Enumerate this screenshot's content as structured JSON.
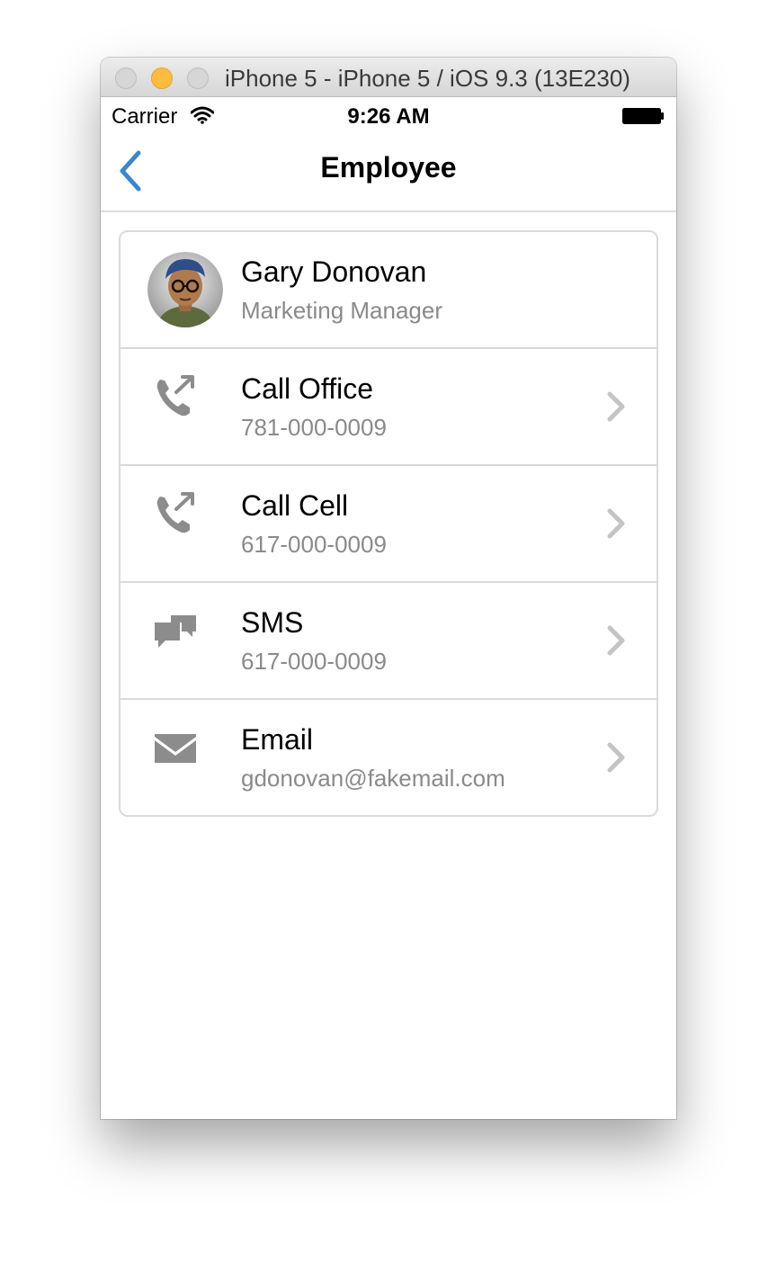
{
  "window": {
    "title": "iPhone 5 - iPhone 5 / iOS 9.3 (13E230)"
  },
  "status_bar": {
    "carrier": "Carrier",
    "time": "9:26 AM",
    "icons": [
      "wifi-icon",
      "battery-icon"
    ]
  },
  "nav": {
    "title": "Employee",
    "back_icon": "chevron-left-icon"
  },
  "employee": {
    "name": "Gary Donovan",
    "role": "Marketing Manager"
  },
  "actions": [
    {
      "label": "Call Office",
      "detail": "781-000-0009",
      "icon": "phone-call-icon"
    },
    {
      "label": "Call Cell",
      "detail": "617-000-0009",
      "icon": "phone-call-icon"
    },
    {
      "label": "SMS",
      "detail": "617-000-0009",
      "icon": "chat-bubbles-icon"
    },
    {
      "label": "Email",
      "detail": "gdonovan@fakemail.com",
      "icon": "envelope-icon"
    }
  ],
  "colors": {
    "accent": "#3a87c9",
    "icon_gray": "#8c8c8c",
    "secondary_text": "#8a8a8a",
    "chevron": "#c4c4c4",
    "divider": "#dadada"
  }
}
